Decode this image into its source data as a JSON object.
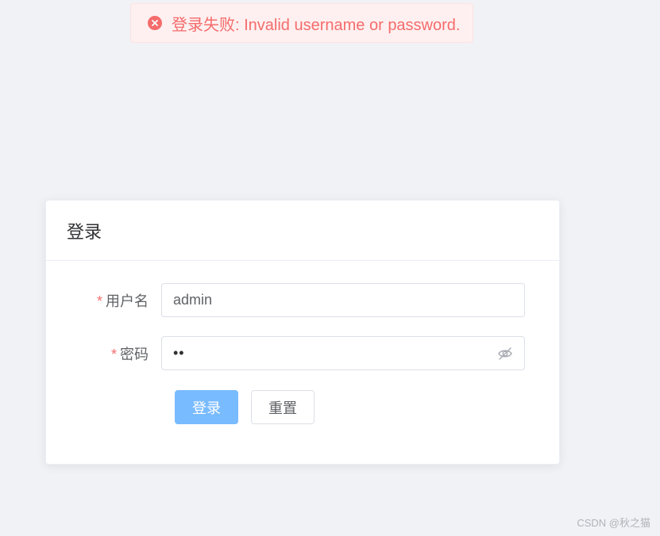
{
  "message": {
    "text": "登录失败: Invalid username or password.",
    "icon": "close-circle-icon",
    "color": "#f56c6c"
  },
  "card": {
    "title": "登录"
  },
  "form": {
    "username": {
      "required_mark": "*",
      "label": "用户名",
      "value": "admin"
    },
    "password": {
      "required_mark": "*",
      "label": "密码",
      "value": "••",
      "toggle_icon": "eye-off-icon"
    }
  },
  "buttons": {
    "login_label": "登录",
    "reset_label": "重置",
    "primary_color": "#79bbff"
  },
  "watermark": "CSDN @秋之猫"
}
